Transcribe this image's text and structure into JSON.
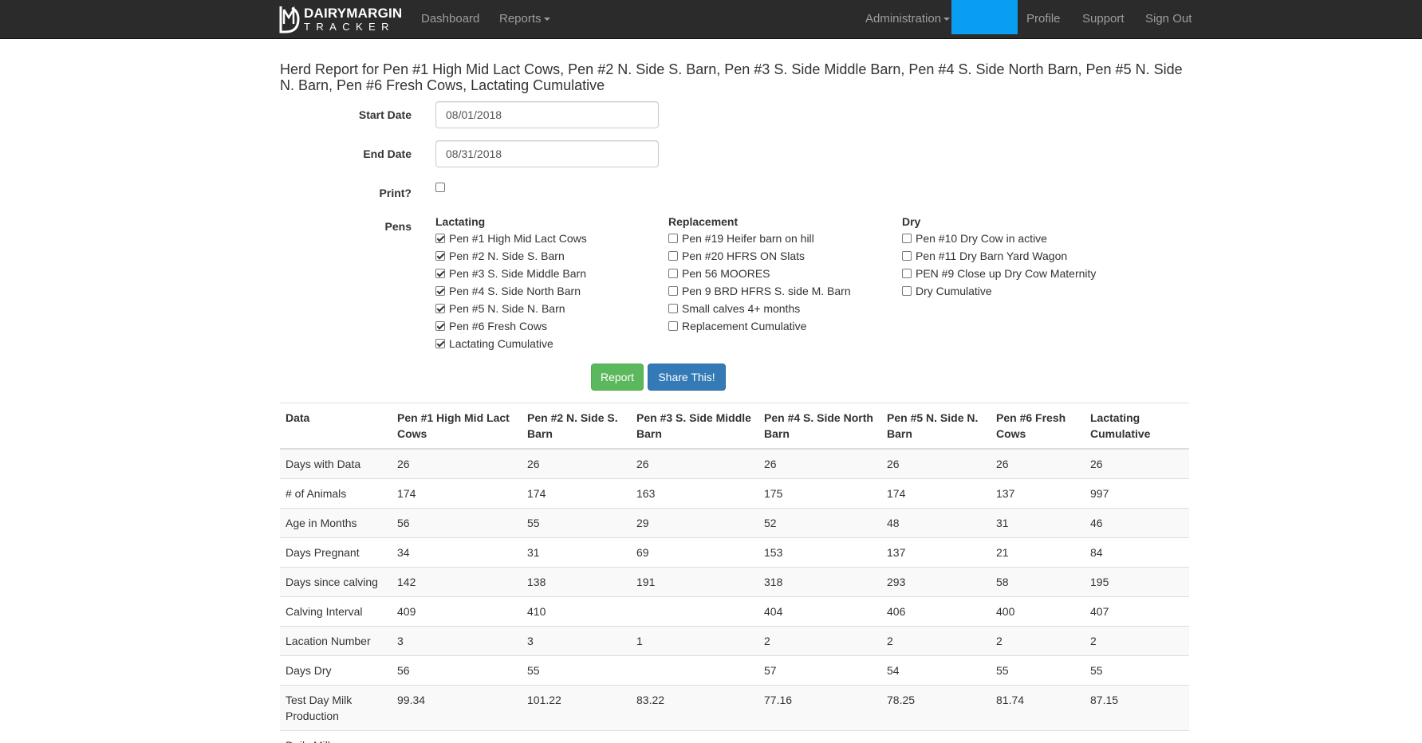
{
  "nav": {
    "brand_line1": "DAIRYMARGIN",
    "brand_line2": "TRACKER",
    "dashboard": "Dashboard",
    "reports": "Reports",
    "administration": "Administration",
    "profile": "Profile",
    "support": "Support",
    "sign_out": "Sign Out"
  },
  "title": "Herd Report for Pen #1 High Mid Lact Cows, Pen #2 N. Side S. Barn, Pen #3 S. Side Middle Barn, Pen #4 S. Side North Barn, Pen #5 N. Side N. Barn, Pen #6 Fresh Cows, Lactating Cumulative",
  "form": {
    "start_date_label": "Start Date",
    "start_date_value": "08/01/2018",
    "end_date_label": "End Date",
    "end_date_value": "08/31/2018",
    "print_label": "Print?",
    "print_checked": false,
    "pens_label": "Pens"
  },
  "pen_groups": [
    {
      "title": "Lactating",
      "items": [
        {
          "label": "Pen #1 High Mid Lact Cows",
          "checked": true
        },
        {
          "label": "Pen #2 N. Side S. Barn",
          "checked": true
        },
        {
          "label": "Pen #3 S. Side Middle Barn",
          "checked": true
        },
        {
          "label": "Pen #4 S. Side North Barn",
          "checked": true
        },
        {
          "label": "Pen #5 N. Side N. Barn",
          "checked": true
        },
        {
          "label": "Pen #6 Fresh Cows",
          "checked": true
        },
        {
          "label": "Lactating Cumulative",
          "checked": true
        }
      ]
    },
    {
      "title": "Replacement",
      "items": [
        {
          "label": "Pen #19 Heifer barn on hill",
          "checked": false
        },
        {
          "label": "Pen #20 HFRS ON Slats",
          "checked": false
        },
        {
          "label": "Pen 56 MOORES",
          "checked": false
        },
        {
          "label": "Pen 9 BRD HFRS S. side M. Barn",
          "checked": false
        },
        {
          "label": "Small calves 4+ months",
          "checked": false
        },
        {
          "label": "Replacement Cumulative",
          "checked": false
        }
      ]
    },
    {
      "title": "Dry",
      "items": [
        {
          "label": "Pen #10 Dry Cow in active",
          "checked": false
        },
        {
          "label": "Pen #11 Dry Barn Yard Wagon",
          "checked": false
        },
        {
          "label": "PEN #9 Close up Dry Cow Maternity",
          "checked": false
        },
        {
          "label": "Dry Cumulative",
          "checked": false
        }
      ]
    }
  ],
  "buttons": {
    "report": "Report",
    "share": "Share This!"
  },
  "table": {
    "headers": [
      "Data",
      "Pen #1 High Mid Lact Cows",
      "Pen #2 N. Side S. Barn",
      "Pen #3 S. Side Middle Barn",
      "Pen #4 S. Side North Barn",
      "Pen #5 N. Side N. Barn",
      "Pen #6 Fresh Cows",
      "Lactating Cumulative"
    ],
    "rows": [
      [
        "Days with Data",
        "26",
        "26",
        "26",
        "26",
        "26",
        "26",
        "26"
      ],
      [
        "# of Animals",
        "174",
        "174",
        "163",
        "175",
        "174",
        "137",
        "997"
      ],
      [
        "Age in Months",
        "56",
        "55",
        "29",
        "52",
        "48",
        "31",
        "46"
      ],
      [
        "Days Pregnant",
        "34",
        "31",
        "69",
        "153",
        "137",
        "21",
        "84"
      ],
      [
        "Days since calving",
        "142",
        "138",
        "191",
        "318",
        "293",
        "58",
        "195"
      ],
      [
        "Calving Interval",
        "409",
        "410",
        "",
        "404",
        "406",
        "400",
        "407"
      ],
      [
        "Lacation Number",
        "3",
        "3",
        "1",
        "2",
        "2",
        "2",
        "2"
      ],
      [
        "Days Dry",
        "56",
        "55",
        "",
        "57",
        "54",
        "55",
        "55"
      ],
      [
        "Test Day Milk Production",
        "99.34",
        "101.22",
        "83.22",
        "77.16",
        "78.25",
        "81.74",
        "87.15"
      ],
      [
        "Daily Milk",
        "",
        "",
        "",
        "",
        "",
        "",
        ""
      ]
    ]
  }
}
